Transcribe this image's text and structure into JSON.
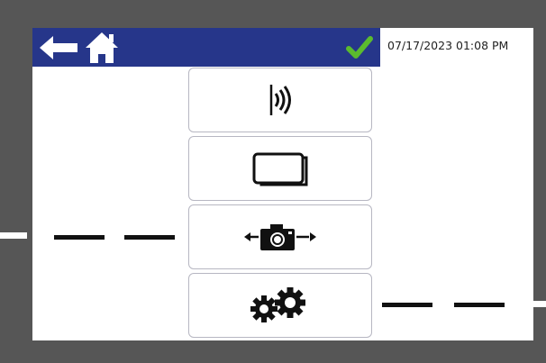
{
  "header": {
    "datetime": "07/17/2023 01:08 PM",
    "back_icon": "arrow-left-icon",
    "home_icon": "home-icon",
    "status_icon": "check-icon"
  },
  "menu": {
    "items": [
      {
        "name": "wireless",
        "icon": "wireless-signal-icon"
      },
      {
        "name": "screen",
        "icon": "screen-rectangle-icon"
      },
      {
        "name": "camera",
        "icon": "camera-switch-icon"
      },
      {
        "name": "settings",
        "icon": "gears-icon"
      }
    ]
  },
  "colors": {
    "bezel": "#565656",
    "header": "#26368a",
    "check": "#5bbb2e",
    "screen": "#ffffff"
  }
}
